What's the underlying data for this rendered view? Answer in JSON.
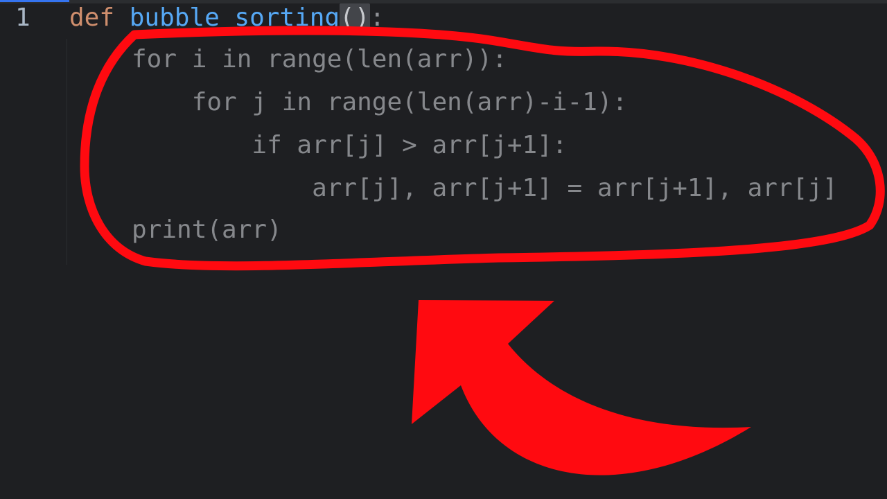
{
  "editor": {
    "line_number": "1",
    "def_keyword": "def",
    "function_name": "bubble_sorting",
    "paren_pair": "()",
    "colon": ":",
    "lines": [
      "for i in range(len(arr)):",
      "    for j in range(len(arr)-i-1):",
      "        if arr[j] > arr[j+1]:",
      "            arr[j], arr[j+1] = arr[j+1], arr[j]",
      "print(arr)"
    ]
  },
  "annotation": {
    "color": "#ff0a10",
    "shapes": [
      "hand-drawn-circle",
      "curved-arrow"
    ]
  }
}
